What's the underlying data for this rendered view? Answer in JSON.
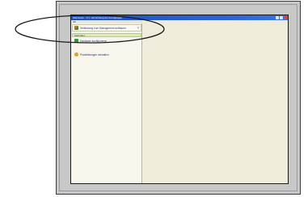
{
  "window": {
    "title": "Wachstum - 0.1 - Einrichtung der Anrufgruppe",
    "menu_text": "Ah"
  },
  "sidebar": {
    "connect_label": "Verbindung zum Management aufbauen",
    "section_header": "Verbindet",
    "section_item": "Hardware konfigurieren",
    "phone_label": "Privatleitungen verwalten"
  },
  "colors": {
    "titlebar": "#2b63d8",
    "highlight": "#d8ee9c",
    "background": "#f0ecdc"
  },
  "icons": [
    "plug-icon",
    "collapse-chevron-icon",
    "config-icon",
    "phone-icon",
    "minimize-icon",
    "maximize-icon",
    "close-icon"
  ]
}
